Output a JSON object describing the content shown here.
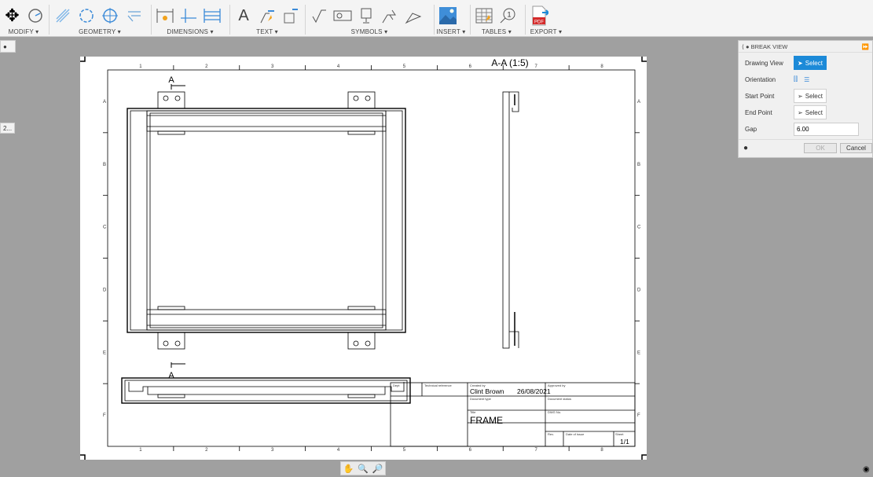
{
  "toolbar": {
    "groups": [
      {
        "label": "MODIFY ▾",
        "icons": [
          "move-icon",
          "rotate-icon"
        ]
      },
      {
        "label": "GEOMETRY ▾",
        "icons": [
          "centerline-icon",
          "center-mark-icon",
          "center-mark-pattern-icon",
          "edge-extension-icon"
        ]
      },
      {
        "label": "DIMENSIONS ▾",
        "icons": [
          "dimension-icon",
          "ordinate-dimension-icon",
          "baseline-dimension-icon"
        ]
      },
      {
        "label": "TEXT ▾",
        "icons": [
          "text-icon",
          "leader-icon",
          "text-style-icon"
        ]
      },
      {
        "label": "SYMBOLS ▾",
        "icons": [
          "surface-texture-icon",
          "feature-control-frame-icon",
          "datum-identifier-icon",
          "welding-symbol-icon",
          "edge-symbol-icon"
        ]
      },
      {
        "label": "INSERT ▾",
        "icons": [
          "insert-image-icon"
        ]
      },
      {
        "label": "TABLES ▾",
        "icons": [
          "table-icon",
          "balloon-icon"
        ]
      },
      {
        "label": "EXPORT ▾",
        "icons": [
          "export-pdf-icon"
        ]
      }
    ],
    "balloon_text": "1",
    "pdf_text": "PDF"
  },
  "side_tabs": {
    "tab2": "2..."
  },
  "sheet": {
    "columns": [
      "1",
      "2",
      "3",
      "4",
      "5",
      "6",
      "7",
      "8"
    ],
    "rows": [
      "A",
      "B",
      "C",
      "D",
      "E",
      "F"
    ],
    "section_label": "A",
    "section_view_title": "A-A (1:5)",
    "title_block": {
      "dept_label": "Dept",
      "tech_ref_label": "Technical reference",
      "created_by_label": "Created by",
      "created_by": "Clint Brown",
      "created_date": "26/08/2021",
      "approved_by_label": "Approved by",
      "doc_type_label": "Document type",
      "doc_status_label": "Document status",
      "title_label": "Title",
      "title": "FRAME",
      "dwg_no_label": "DWG No.",
      "rev_label": "Rev.",
      "date_issue_label": "Date of issue",
      "sheet_label": "Sheet",
      "sheet": "1/1"
    }
  },
  "panel": {
    "title": "BREAK VIEW",
    "drawing_view_label": "Drawing View",
    "orientation_label": "Orientation",
    "start_point_label": "Start Point",
    "end_point_label": "End Point",
    "gap_label": "Gap",
    "select_label": "Select",
    "gap_value": "6.00",
    "ok_label": "OK",
    "cancel_label": "Cancel"
  },
  "colors": {
    "accent": "#1c8ad8",
    "canvas": "#a0a0a0"
  }
}
